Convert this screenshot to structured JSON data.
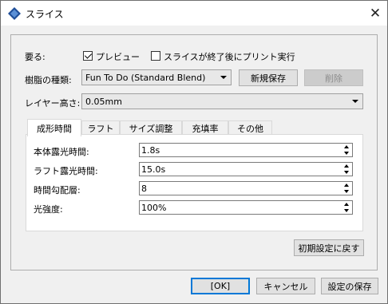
{
  "window": {
    "title": "スライス",
    "icon": "app-diamond-icon",
    "accent": "#0078d7"
  },
  "row_preview": {
    "label": "要る:",
    "preview_checkbox": {
      "label": "プレビュー",
      "checked": true
    },
    "print_after_checkbox": {
      "label": "スライスが終了後にプリント実行",
      "checked": false
    }
  },
  "row_resin": {
    "label": "樹脂の種類:",
    "selected": "Fun To Do (Standard Blend)",
    "new_save_button": "新規保存",
    "delete_button": "削除"
  },
  "row_layer": {
    "label": "レイヤー高さ:",
    "selected": "0.05mm"
  },
  "tabs": [
    {
      "label": "成形時間",
      "active": true
    },
    {
      "label": "ラフト",
      "active": false
    },
    {
      "label": "サイズ調整",
      "active": false
    },
    {
      "label": "充填率",
      "active": false
    },
    {
      "label": "その他",
      "active": false
    }
  ],
  "fields": [
    {
      "label": "本体露光時間:",
      "value": "1.8s"
    },
    {
      "label": "ラフト露光時間:",
      "value": "15.0s"
    },
    {
      "label": "時間勾配層:",
      "value": "8"
    },
    {
      "label": "光強度:",
      "value": "100%"
    }
  ],
  "reset_button": "初期設定に戻す",
  "footer": {
    "ok": "[OK]",
    "cancel": "キャンセル",
    "save": "設定の保存"
  }
}
